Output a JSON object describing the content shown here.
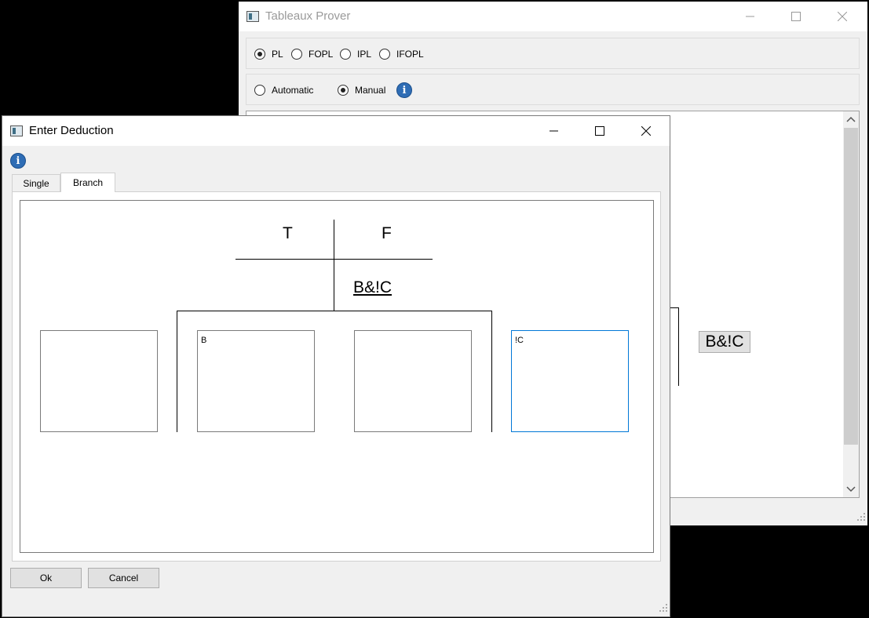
{
  "main_window": {
    "title": "Tableaux Prover",
    "logic_options": [
      {
        "label": "PL",
        "selected": true
      },
      {
        "label": "FOPL",
        "selected": false
      },
      {
        "label": "IPL",
        "selected": false
      },
      {
        "label": "IFOPL",
        "selected": false
      }
    ],
    "mode_options": [
      {
        "label": "Automatic",
        "selected": false
      },
      {
        "label": "Manual",
        "selected": true
      }
    ],
    "canvas_formula": "B&!C"
  },
  "dialog": {
    "title": "Enter Deduction",
    "tabs": [
      {
        "label": "Single",
        "active": false
      },
      {
        "label": "Branch",
        "active": true
      }
    ],
    "header_true": "T",
    "header_false": "F",
    "formula": "B&!C",
    "inputs": [
      "",
      "B",
      "",
      "!C"
    ],
    "ok_label": "Ok",
    "cancel_label": "Cancel"
  },
  "icons": [
    "app-icon",
    "info-icon",
    "minimize-icon",
    "maximize-icon",
    "close-icon",
    "scroll-up-icon",
    "scroll-down-icon",
    "resize-grip-icon"
  ],
  "colors": {
    "info_blue": "#2f6db5",
    "focus_blue": "#0078d7"
  }
}
